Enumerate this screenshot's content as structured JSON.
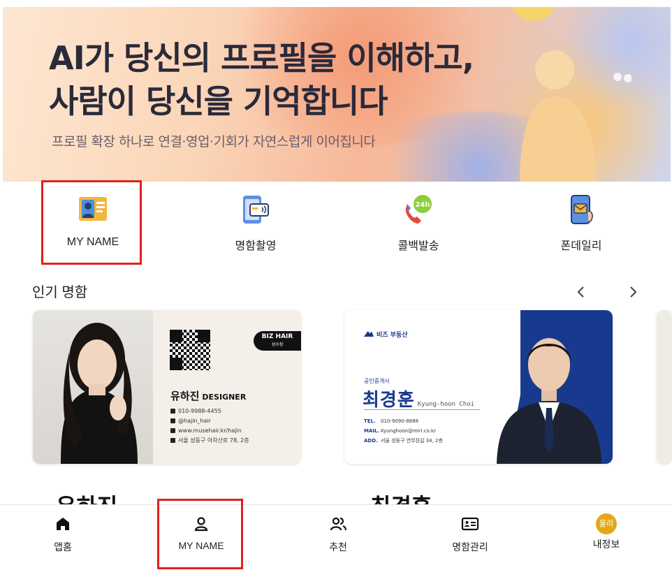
{
  "banner": {
    "title": "AI가 당신의 프로필을 이해하고,\n사람이 당신을 기억합니다",
    "subtitle": "프로필 확장 하나로 연결·영업·기회가 자연스럽게 이어집니다"
  },
  "quick_menu": [
    {
      "label": "MY NAME",
      "icon": "profile-card-icon"
    },
    {
      "label": "명함촬영",
      "icon": "card-scan-icon"
    },
    {
      "label": "콜백발송",
      "icon": "callback-24h-icon"
    },
    {
      "label": "폰데일리",
      "icon": "phone-mail-icon"
    }
  ],
  "popular": {
    "title": "인기 명함",
    "prev": "‹",
    "next": "›"
  },
  "cards": [
    {
      "brand": "BIZ HAIR",
      "brand_sub": "성수점",
      "name": "유하진",
      "title": "DESIGNER",
      "lines": [
        "010-9988-4455",
        "@hajin_hair",
        "www.musehair.kr/hajin",
        "서울 성동구 아차산로 78, 2층"
      ],
      "owner": "유하진"
    },
    {
      "brand": "비즈 부동산",
      "role": "공인중개사",
      "name": "최경훈",
      "name_en": "Kyung-hoon Choi",
      "tel_label": "TEL.",
      "tel": "010-9090-8888",
      "mail_label": "MAIL.",
      "mail": "Kyunghoon@miri.co.kr",
      "add_label": "ADD.",
      "add": "서울 성동구 연무장길 34, 2층",
      "owner": "최경훈"
    }
  ],
  "bottom_nav": [
    {
      "label": "앱홈",
      "icon": "home-icon"
    },
    {
      "label": "MY NAME",
      "icon": "person-icon"
    },
    {
      "label": "추천",
      "icon": "people-icon"
    },
    {
      "label": "명함관리",
      "icon": "id-card-icon"
    },
    {
      "label": "내정보",
      "icon": "avatar",
      "avatar_text": "울리"
    }
  ],
  "colors": {
    "highlight": "#e02020",
    "card_blue": "#183a8e",
    "avatar": "#e5a718"
  }
}
